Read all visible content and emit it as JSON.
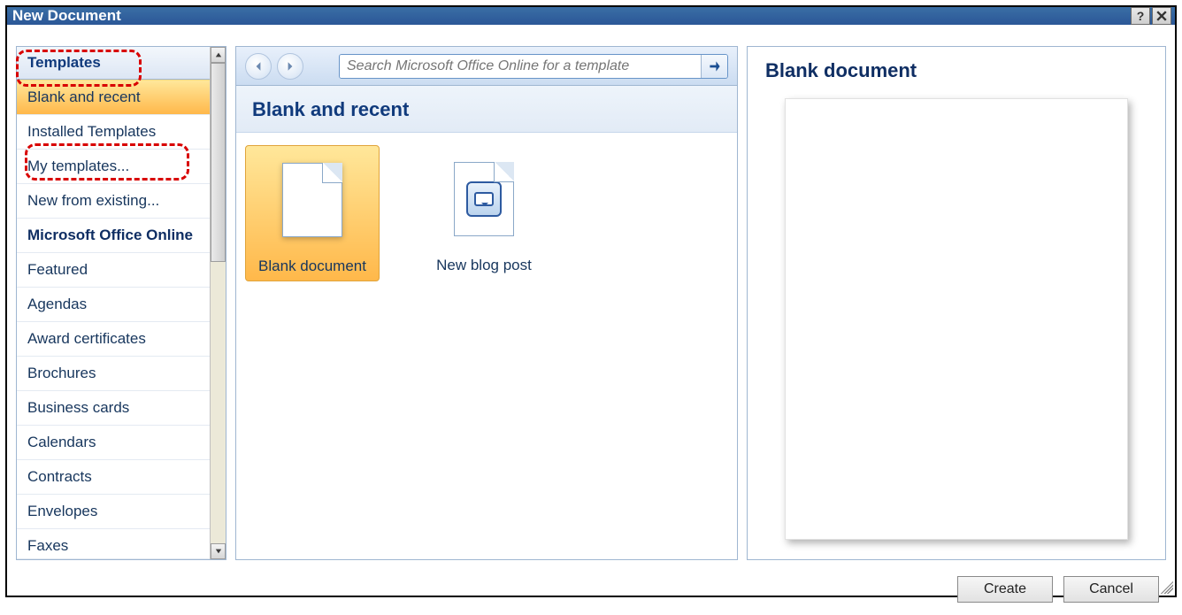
{
  "window": {
    "title": "New Document"
  },
  "sidebar": {
    "header": "Templates",
    "items": [
      {
        "label": "Blank and recent",
        "selected": true
      },
      {
        "label": "Installed Templates"
      },
      {
        "label": "My templates..."
      },
      {
        "label": "New from existing..."
      },
      {
        "label": "Microsoft Office Online",
        "section_head": true
      },
      {
        "label": "Featured"
      },
      {
        "label": "Agendas"
      },
      {
        "label": "Award certificates"
      },
      {
        "label": "Brochures"
      },
      {
        "label": "Business cards"
      },
      {
        "label": "Calendars"
      },
      {
        "label": "Contracts"
      },
      {
        "label": "Envelopes"
      },
      {
        "label": "Faxes"
      }
    ]
  },
  "search": {
    "placeholder": "Search Microsoft Office Online for a template"
  },
  "main": {
    "section_title": "Blank and recent",
    "tiles": [
      {
        "label": "Blank document",
        "icon": "doc",
        "selected": true
      },
      {
        "label": "New blog post",
        "icon": "blog"
      }
    ]
  },
  "preview": {
    "title": "Blank document"
  },
  "footer": {
    "create": "Create",
    "cancel": "Cancel"
  }
}
